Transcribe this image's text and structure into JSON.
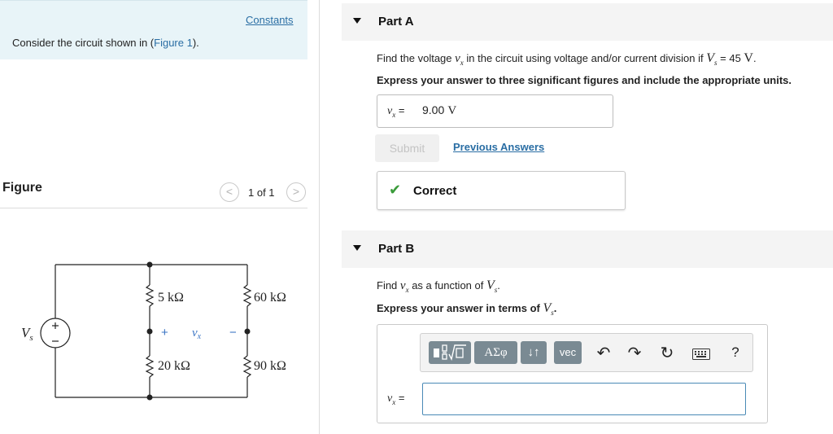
{
  "left": {
    "constants_link": "Constants",
    "intro_prefix": "Consider the circuit shown in (",
    "intro_link": "Figure 1",
    "intro_suffix": ").",
    "figure_label": "Figure",
    "pager": {
      "prev": "<",
      "count": "1 of 1",
      "next": ">"
    },
    "circuit": {
      "source_label": "V",
      "source_sub": "s",
      "r1": "5 kΩ",
      "r2": "60 kΩ",
      "r3": "20 kΩ",
      "r4": "90 kΩ",
      "vx_label": "v",
      "vx_sub": "x",
      "plus": "+",
      "minus": "−"
    }
  },
  "partA": {
    "title": "Part A",
    "question_prefix": "Find the voltage ",
    "question_var": "v",
    "question_var_sub": "x",
    "question_mid": " in the circuit using voltage and/or current division if ",
    "question_vs": "V",
    "question_vs_sub": "s",
    "question_eq": " = 45 ",
    "question_unit": "V",
    "question_end": ".",
    "instruction": "Express your answer to three significant figures and include the appropriate units.",
    "answer_var": "v",
    "answer_var_sub": "x",
    "answer_eq": " = ",
    "answer_value": "9.00",
    "answer_unit": "V",
    "submit_label": "Submit",
    "previous_answers": "Previous Answers",
    "feedback_icon": "checkmark-icon",
    "feedback": "Correct"
  },
  "partB": {
    "title": "Part B",
    "question_prefix": "Find ",
    "question_var": "v",
    "question_var_sub": "x",
    "question_mid": " as a function of ",
    "question_vs": "V",
    "question_vs_sub": "s",
    "question_end": ".",
    "instruction_prefix": "Express your answer in terms of ",
    "instruction_vs": "V",
    "instruction_vs_sub": "s",
    "instruction_end": ".",
    "toolbar": {
      "templates": "template-icon",
      "greek": "ΑΣφ",
      "arrows": "↓↑",
      "vec": "vec",
      "undo": "undo-icon",
      "redo": "redo-icon",
      "reset": "reset-icon",
      "keyboard": "keyboard-icon",
      "help": "?"
    },
    "answer_var": "v",
    "answer_var_sub": "x",
    "answer_eq": " =",
    "answer_value": ""
  },
  "colors": {
    "link": "#2a6ea4",
    "intro_bg": "#e8f4f8",
    "correct_green": "#3a9b3a",
    "tool_button": "#7a8a93",
    "input_border": "#4a8ab6",
    "vx_blue": "#3a74c4"
  }
}
